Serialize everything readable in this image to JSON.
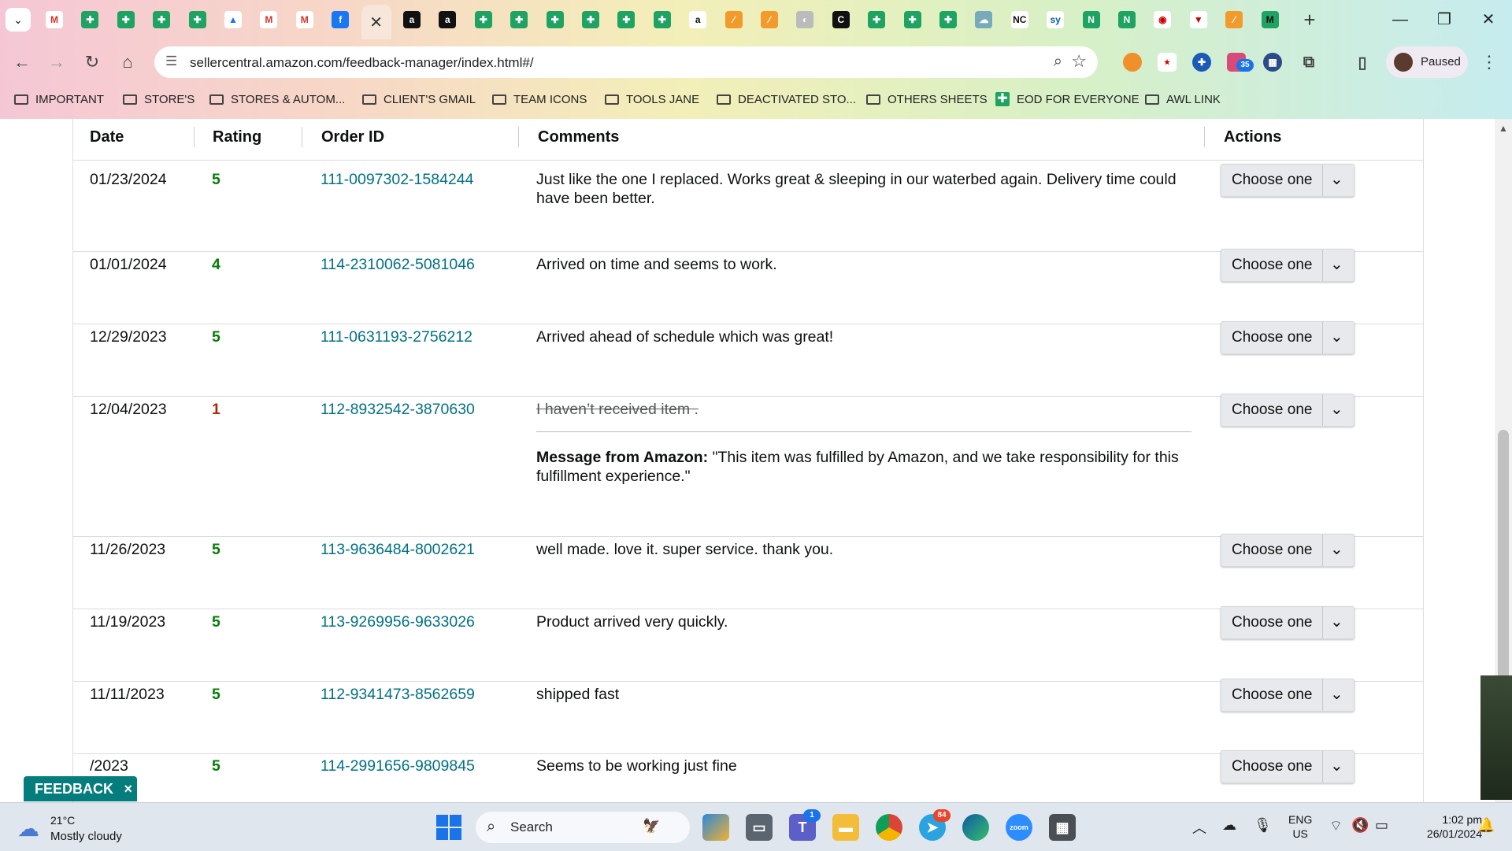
{
  "browser": {
    "url": "sellercentral.amazon.com/feedback-manager/index.html#/",
    "profile_label": "Paused",
    "tab_favicons": [
      "gmail-icon",
      "google-sheets-icon",
      "google-sheets-icon",
      "google-sheets-icon",
      "google-sheets-icon",
      "google-drive-icon",
      "gmail-icon",
      "gmail-icon",
      "facebook-icon",
      "close-icon",
      "amazon-icon",
      "amazon-icon",
      "google-sheets-icon",
      "google-sheets-icon",
      "google-sheets-icon",
      "google-sheets-icon",
      "google-sheets-icon",
      "google-sheets-icon",
      "amazon-smile-icon",
      "app-icon",
      "app-icon",
      "globe-icon",
      "c-icon",
      "google-sheets-icon",
      "google-sheets-icon",
      "google-sheets-icon",
      "cloud-icon",
      "nc-icon",
      "sysco-icon",
      "n-icon",
      "n-icon",
      "circle-icon",
      "triangle-icon",
      "app-icon",
      "m-icon"
    ],
    "extension_badge": "35",
    "bookmarks": [
      {
        "label": "IMPORTANT",
        "type": "folder"
      },
      {
        "label": "STORE'S",
        "type": "folder"
      },
      {
        "label": "STORES & AUTOM...",
        "type": "folder"
      },
      {
        "label": "CLIENT'S GMAIL",
        "type": "folder"
      },
      {
        "label": "TEAM ICONS",
        "type": "folder"
      },
      {
        "label": "TOOLS JANE",
        "type": "folder"
      },
      {
        "label": "DEACTIVATED STO...",
        "type": "folder"
      },
      {
        "label": "OTHERS SHEETS",
        "type": "folder"
      },
      {
        "label": "EOD FOR EVERYONE",
        "type": "sheet"
      },
      {
        "label": "AWL LINK",
        "type": "folder"
      }
    ]
  },
  "table": {
    "headers": {
      "date": "Date",
      "rating": "Rating",
      "order_id": "Order ID",
      "comments": "Comments",
      "actions": "Actions"
    },
    "rows": [
      {
        "date": "01/23/2024",
        "rating": "5",
        "order_id": "111-0097302-1584244",
        "comment": "Just like the one I replaced. Works great & sleeping in our waterbed again. Delivery time could have been better.",
        "action": "Choose one"
      },
      {
        "date": "01/01/2024",
        "rating": "4",
        "order_id": "114-2310062-5081046",
        "comment": "Arrived on time and seems to work.",
        "action": "Choose one"
      },
      {
        "date": "12/29/2023",
        "rating": "5",
        "order_id": "111-0631193-2756212",
        "comment": "Arrived ahead of schedule which was great!",
        "action": "Choose one"
      },
      {
        "date": "12/04/2023",
        "rating": "1",
        "order_id": "112-8932542-3870630",
        "comment": "I haven’t received item .",
        "comment_struck": true,
        "message_label": "Message from Amazon:",
        "message_text": "\"This item was fulfilled by Amazon, and we take responsibility for this fulfillment experience.\"",
        "action": "Choose one"
      },
      {
        "date": "11/26/2023",
        "rating": "5",
        "order_id": "113-9636484-8002621",
        "comment": "well made. love it. super service. thank you.",
        "action": "Choose one"
      },
      {
        "date": "11/19/2023",
        "rating": "5",
        "order_id": "113-9269956-9633026",
        "comment": "Product arrived very quickly.",
        "action": "Choose one"
      },
      {
        "date": "11/11/2023",
        "rating": "5",
        "order_id": "112-9341473-8562659",
        "comment": "shipped fast",
        "action": "Choose one"
      },
      {
        "date": "/2023",
        "rating": "5",
        "order_id": "114-2991656-9809845",
        "comment": "Seems to be working just fine",
        "action": "Choose one"
      }
    ]
  },
  "feedback_tab": {
    "label": "FEEDBACK",
    "close": "×"
  },
  "taskbar": {
    "weather_temp": "21°C",
    "weather_condition": "Mostly cloudy",
    "search_label": "Search",
    "teams_badge": "1",
    "telegram_badge": "84",
    "language_line1": "ENG",
    "language_line2": "US",
    "time": "1:02 pm",
    "date": "26/01/2024"
  },
  "colors": {
    "rating_good": "#067d06",
    "rating_bad": "#b12704",
    "order_link": "#007185",
    "feedback_tab": "#067d7d"
  }
}
